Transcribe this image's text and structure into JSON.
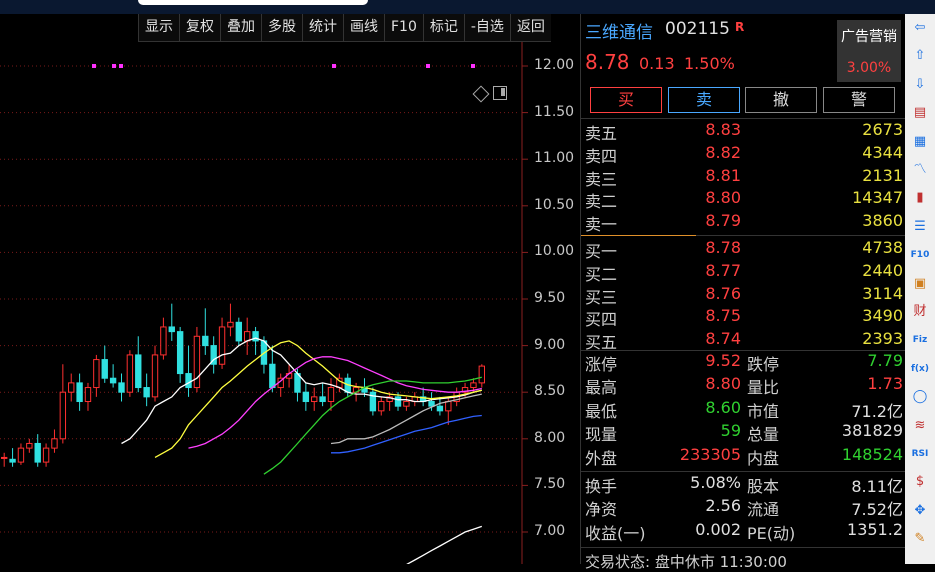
{
  "toolbar": {
    "items": [
      "显示",
      "复权",
      "叠加",
      "多股",
      "统计",
      "画线",
      "F10",
      "标记",
      "-自选",
      "返回"
    ]
  },
  "chart": {
    "y_labels": [
      "12.00",
      "11.50",
      "11.00",
      "10.50",
      "10.00",
      "9.50",
      "9.00",
      "8.50",
      "8.00",
      "7.50",
      "7.00"
    ]
  },
  "chart_data": {
    "type": "candlestick",
    "ylim": [
      6.8,
      12.3
    ],
    "candles": [
      [
        7.8,
        7.85,
        7.7,
        7.8
      ],
      [
        7.78,
        7.9,
        7.7,
        7.75
      ],
      [
        7.75,
        7.95,
        7.72,
        7.9
      ],
      [
        7.9,
        8.0,
        7.85,
        7.95
      ],
      [
        7.95,
        8.05,
        7.7,
        7.75
      ],
      [
        7.75,
        7.95,
        7.7,
        7.9
      ],
      [
        7.9,
        8.1,
        7.85,
        8.0
      ],
      [
        8.0,
        8.8,
        7.95,
        8.5
      ],
      [
        8.5,
        8.7,
        8.4,
        8.6
      ],
      [
        8.6,
        8.7,
        8.3,
        8.4
      ],
      [
        8.4,
        8.6,
        8.3,
        8.55
      ],
      [
        8.55,
        8.9,
        8.45,
        8.85
      ],
      [
        8.85,
        9.0,
        8.6,
        8.65
      ],
      [
        8.65,
        8.8,
        8.55,
        8.6
      ],
      [
        8.6,
        8.7,
        8.4,
        8.5
      ],
      [
        8.5,
        8.95,
        8.45,
        8.9
      ],
      [
        8.9,
        9.1,
        8.5,
        8.55
      ],
      [
        8.55,
        8.7,
        8.35,
        8.45
      ],
      [
        8.45,
        9.0,
        8.4,
        8.9
      ],
      [
        8.9,
        9.3,
        8.85,
        9.2
      ],
      [
        9.2,
        9.45,
        9.05,
        9.15
      ],
      [
        9.15,
        9.2,
        8.6,
        8.7
      ],
      [
        8.7,
        9.0,
        8.45,
        8.55
      ],
      [
        8.55,
        9.2,
        8.5,
        9.1
      ],
      [
        9.1,
        9.4,
        8.9,
        9.0
      ],
      [
        9.0,
        9.1,
        8.7,
        8.8
      ],
      [
        8.8,
        9.3,
        8.75,
        9.2
      ],
      [
        9.2,
        9.45,
        9.1,
        9.25
      ],
      [
        9.25,
        9.3,
        9.0,
        9.05
      ],
      [
        9.05,
        9.3,
        8.9,
        9.15
      ],
      [
        9.15,
        9.2,
        8.9,
        9.05
      ],
      [
        9.05,
        9.1,
        8.7,
        8.8
      ],
      [
        8.8,
        9.0,
        8.5,
        8.55
      ],
      [
        8.55,
        8.7,
        8.45,
        8.65
      ],
      [
        8.65,
        8.8,
        8.55,
        8.7
      ],
      [
        8.7,
        8.75,
        8.4,
        8.5
      ],
      [
        8.5,
        8.6,
        8.3,
        8.4
      ],
      [
        8.4,
        8.55,
        8.3,
        8.45
      ],
      [
        8.45,
        8.6,
        8.35,
        8.4
      ],
      [
        8.4,
        8.65,
        8.3,
        8.55
      ],
      [
        8.55,
        8.7,
        8.5,
        8.65
      ],
      [
        8.65,
        8.7,
        8.45,
        8.5
      ],
      [
        8.5,
        8.6,
        8.4,
        8.55
      ],
      [
        8.55,
        8.65,
        8.45,
        8.5
      ],
      [
        8.5,
        8.55,
        8.25,
        8.3
      ],
      [
        8.3,
        8.45,
        8.25,
        8.4
      ],
      [
        8.4,
        8.5,
        8.3,
        8.45
      ],
      [
        8.45,
        8.5,
        8.3,
        8.35
      ],
      [
        8.35,
        8.45,
        8.3,
        8.4
      ],
      [
        8.4,
        8.5,
        8.35,
        8.45
      ],
      [
        8.45,
        8.55,
        8.35,
        8.4
      ],
      [
        8.4,
        8.5,
        8.3,
        8.35
      ],
      [
        8.35,
        8.45,
        8.25,
        8.3
      ],
      [
        8.3,
        8.45,
        8.15,
        8.4
      ],
      [
        8.4,
        8.55,
        8.35,
        8.5
      ],
      [
        8.5,
        8.6,
        8.45,
        8.55
      ],
      [
        8.55,
        8.65,
        8.5,
        8.6
      ],
      [
        8.6,
        8.8,
        8.55,
        8.78
      ]
    ],
    "ma": [
      {
        "color": "#ffffff",
        "values": [
          7.95,
          8.0,
          8.1,
          8.2,
          8.35,
          8.4,
          8.45,
          8.55,
          8.6,
          8.65,
          8.75,
          8.85,
          8.9,
          8.92,
          9.0,
          9.05,
          9.08,
          9.05,
          8.95,
          8.9,
          8.8,
          8.7,
          8.6,
          8.58,
          8.6,
          8.58,
          8.55,
          8.5,
          8.48,
          8.48,
          8.46,
          8.45,
          8.44,
          8.42,
          8.42,
          8.4,
          8.4,
          8.42,
          8.43,
          8.44,
          8.45,
          8.47,
          8.5,
          8.52
        ]
      },
      {
        "color": "#ffff40",
        "values": [
          7.8,
          7.85,
          7.9,
          8.0,
          8.15,
          8.25,
          8.35,
          8.45,
          8.55,
          8.62,
          8.7,
          8.78,
          8.85,
          8.92,
          8.98,
          9.03,
          9.05,
          9.0,
          8.92,
          8.85,
          8.78,
          8.7,
          8.62,
          8.58,
          8.56,
          8.55,
          8.53,
          8.5,
          8.48,
          8.47,
          8.46,
          8.45,
          8.44,
          8.43,
          8.44,
          8.45,
          8.46,
          8.48,
          8.5,
          8.52
        ]
      },
      {
        "color": "#ff40ff",
        "values": [
          7.9,
          7.92,
          7.95,
          8.0,
          8.05,
          8.12,
          8.2,
          8.3,
          8.4,
          8.48,
          8.55,
          8.62,
          8.7,
          8.76,
          8.82,
          8.86,
          8.88,
          8.88,
          8.86,
          8.84,
          8.8,
          8.76,
          8.72,
          8.68,
          8.64,
          8.6,
          8.57,
          8.55,
          8.53,
          8.52,
          8.51,
          8.5,
          8.5,
          8.51,
          8.52,
          8.54
        ]
      },
      {
        "color": "#30d030",
        "values": [
          7.62,
          7.68,
          7.75,
          7.85,
          7.95,
          8.05,
          8.15,
          8.25,
          8.33,
          8.4,
          8.45,
          8.5,
          8.55,
          8.58,
          8.6,
          8.62,
          8.62,
          8.62,
          8.61,
          8.6,
          8.6,
          8.6,
          8.6,
          8.61,
          8.62,
          8.64,
          8.66
        ]
      },
      {
        "color": "#bbbbbb",
        "values": [
          7.95,
          7.96,
          8.0,
          8.0,
          8.0,
          8.02,
          8.06,
          8.1,
          8.15,
          8.2,
          8.25,
          8.3,
          8.34,
          8.38,
          8.4,
          8.42,
          8.44,
          8.46,
          8.48
        ]
      },
      {
        "color": "#3060ff",
        "values": [
          7.85,
          7.85,
          7.86,
          7.88,
          7.9,
          7.93,
          7.96,
          7.99,
          8.02,
          8.05,
          8.08,
          8.1,
          8.12,
          8.15,
          8.18,
          8.2,
          8.22,
          8.24,
          8.25
        ]
      },
      {
        "color": "#ffffff",
        "values": [
          6.6,
          6.65,
          6.7,
          6.75,
          6.8,
          6.85,
          6.9,
          6.95,
          7.0,
          7.03,
          7.06
        ]
      }
    ],
    "markers_y": 12.0
  },
  "stock": {
    "name": "三维通信",
    "code": "002115",
    "badge": "R",
    "price": "8.78",
    "change": "0.13",
    "pct": "1.50%",
    "ad_label": "广告营销",
    "ad_value": "3.00%"
  },
  "actions": {
    "buy": "买",
    "sell": "卖",
    "cancel": "撤",
    "alert": "警"
  },
  "asks": [
    {
      "label": "卖五",
      "price": "8.83",
      "vol": "2673"
    },
    {
      "label": "卖四",
      "price": "8.82",
      "vol": "4344"
    },
    {
      "label": "卖三",
      "price": "8.81",
      "vol": "2131"
    },
    {
      "label": "卖二",
      "price": "8.80",
      "vol": "14347"
    },
    {
      "label": "卖一",
      "price": "8.79",
      "vol": "3860"
    }
  ],
  "bids": [
    {
      "label": "买一",
      "price": "8.78",
      "vol": "4738"
    },
    {
      "label": "买二",
      "price": "8.77",
      "vol": "2440"
    },
    {
      "label": "买三",
      "price": "8.76",
      "vol": "3114"
    },
    {
      "label": "买四",
      "price": "8.75",
      "vol": "3490"
    },
    {
      "label": "买五",
      "price": "8.74",
      "vol": "2393"
    }
  ],
  "stats1": [
    {
      "l1": "涨停",
      "v1": "9.52",
      "c1": "red",
      "l2": "跌停",
      "v2": "7.79",
      "c2": "green"
    },
    {
      "l1": "最高",
      "v1": "8.80",
      "c1": "red",
      "l2": "量比",
      "v2": "1.73",
      "c2": "red"
    },
    {
      "l1": "最低",
      "v1": "8.60",
      "c1": "green",
      "l2": "市值",
      "v2": "71.2亿",
      "c2": "white"
    },
    {
      "l1": "现量",
      "v1": "59",
      "c1": "green",
      "l2": "总量",
      "v2": "381829",
      "c2": "white"
    },
    {
      "l1": "外盘",
      "v1": "233305",
      "c1": "red",
      "l2": "内盘",
      "v2": "148524",
      "c2": "green"
    }
  ],
  "stats2": [
    {
      "l1": "换手",
      "v1": "5.08%",
      "c1": "white",
      "l2": "股本",
      "v2": "8.11亿",
      "c2": "white"
    },
    {
      "l1": "净资",
      "v1": "2.56",
      "c1": "white",
      "l2": "流通",
      "v2": "7.52亿",
      "c2": "white"
    },
    {
      "l1": "收益(一)",
      "v1": "0.002",
      "c1": "white",
      "l2": "PE(动)",
      "v2": "1351.2",
      "c2": "white"
    }
  ],
  "status": "交易状态: 盘中休市 11:30:00",
  "rightbar": [
    {
      "name": "arrow-left-icon",
      "glyph": "⇦",
      "color": "#1a6fe0"
    },
    {
      "name": "arrow-up-icon",
      "glyph": "⇧",
      "color": "#1a6fe0"
    },
    {
      "name": "arrow-down-icon",
      "glyph": "⇩",
      "color": "#1a6fe0"
    },
    {
      "name": "report-icon",
      "glyph": "▤",
      "color": "#c03030"
    },
    {
      "name": "grid-icon",
      "glyph": "▦",
      "color": "#1a6fe0"
    },
    {
      "name": "line-chart-icon",
      "glyph": "〽",
      "color": "#1a6fe0"
    },
    {
      "name": "candle-icon",
      "glyph": "▮",
      "color": "#c03030"
    },
    {
      "name": "list-icon",
      "glyph": "☰",
      "color": "#1a6fe0"
    },
    {
      "name": "f10-icon",
      "glyph": "F10",
      "color": "#1a6fe0"
    },
    {
      "name": "document-icon",
      "glyph": "▣",
      "color": "#d08020"
    },
    {
      "name": "finance-icon",
      "glyph": "财",
      "color": "#c03030"
    },
    {
      "name": "fiz-icon",
      "glyph": "Fiz",
      "color": "#1a6fe0"
    },
    {
      "name": "formula-icon",
      "glyph": "f(x)",
      "color": "#1a6fe0"
    },
    {
      "name": "circle-icon",
      "glyph": "◯",
      "color": "#1a6fe0"
    },
    {
      "name": "wave-icon",
      "glyph": "≋",
      "color": "#c03030"
    },
    {
      "name": "rsi-icon",
      "glyph": "RSI",
      "color": "#1a6fe0"
    },
    {
      "name": "dollar-icon",
      "glyph": "$",
      "color": "#c03030"
    },
    {
      "name": "move-icon",
      "glyph": "✥",
      "color": "#1a6fe0"
    },
    {
      "name": "pen-icon",
      "glyph": "✎",
      "color": "#d08020"
    }
  ]
}
